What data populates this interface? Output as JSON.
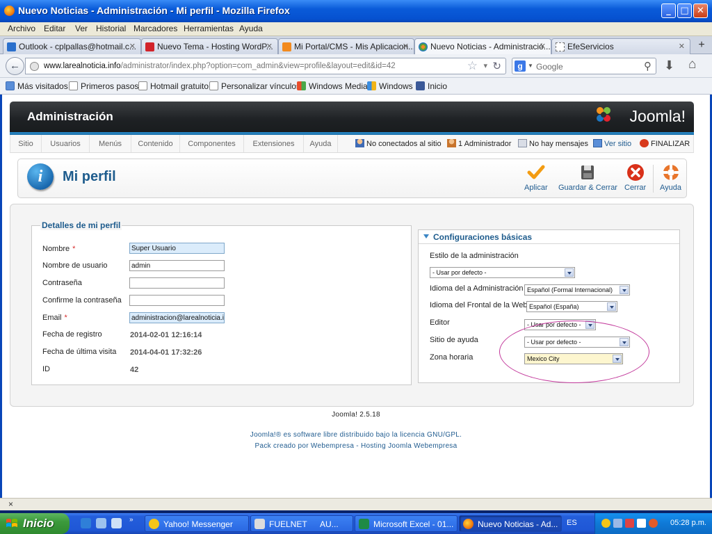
{
  "window": {
    "title": "Nuevo Noticias - Administración - Mi perfil - Mozilla Firefox"
  },
  "menubar": [
    "Archivo",
    "Editar",
    "Ver",
    "Historial",
    "Marcadores",
    "Herramientas",
    "Ayuda"
  ],
  "tabs": [
    {
      "label": "Outlook - cplpallas@hotmail.c..."
    },
    {
      "label": "Nuevo Tema - Hosting WordP..."
    },
    {
      "label": "Mi Portal/CMS - Mis Aplicacion..."
    },
    {
      "label": "Nuevo Noticias - Administració..."
    },
    {
      "label": "EfeServicios"
    }
  ],
  "navbar": {
    "url_domain": "www.larealnoticia.info",
    "url_path": "/administrator/index.php?option=com_admin&view=profile&layout=edit&id=42",
    "search_placeholder": "Google"
  },
  "bookmarks": [
    "Más visitados",
    "Primeros pasos",
    "Hotmail gratuito",
    "Personalizar vínculos",
    "Windows Media",
    "Windows",
    "Inicio"
  ],
  "joomla": {
    "header_title": "Administración",
    "logo_text": "Joomla!",
    "menu": [
      "Sitio",
      "Usuarios",
      "Menús",
      "Contenido",
      "Componentes",
      "Extensiones",
      "Ayuda"
    ],
    "status": {
      "not_connected": "No conectados al sitio",
      "admins": "1 Administrador",
      "messages": "No hay mensajes",
      "view_site": "Ver sitio",
      "logout": "FINALIZAR"
    },
    "page_title": "Mi perfil",
    "toolbar": {
      "apply": "Aplicar",
      "save_close": "Guardar & Cerrar",
      "close": "Cerrar",
      "help": "Ayuda"
    },
    "profile": {
      "legend": "Detalles de mi perfil",
      "name_label": "Nombre",
      "name_value": "Super Usuario",
      "username_label": "Nombre de usuario",
      "username_value": "admin",
      "password_label": "Contraseña",
      "password_value": "",
      "confirm_label": "Confirme la contraseña",
      "confirm_value": "",
      "email_label": "Email",
      "email_value": "administracion@larealnoticia.info",
      "register_label": "Fecha de registro",
      "register_value": "2014-02-01 12:16:14",
      "lastvisit_label": "Fecha de última visita",
      "lastvisit_value": "2014-04-01 17:32:26",
      "id_label": "ID",
      "id_value": "42"
    },
    "settings": {
      "header": "Configuraciones básicas",
      "admin_style_label": "Estilo de la administración",
      "admin_style_value": "- Usar por defecto -",
      "admin_lang_label": "Idioma del a Administración",
      "admin_lang_value": "Español (Formal Internacional)",
      "site_lang_label": "Idioma del Frontal de la Web",
      "site_lang_value": "Español (España)",
      "editor_label": "Editor",
      "editor_value": "- Usar por defecto -",
      "help_site_label": "Sitio de ayuda",
      "help_site_value": "- Usar por defecto -",
      "timezone_label": "Zona horaria",
      "timezone_value": "Mexico City"
    },
    "footer": {
      "version": "Joomla! 2.5.18",
      "license": "Joomla!® es software libre distribuido bajo la licencia GNU/GPL.",
      "pack": "Pack creado por Webempresa - Hosting Joomla Webempresa"
    }
  },
  "statusbar": {
    "close": "×"
  },
  "taskbar": {
    "start": "Inicio",
    "items": [
      "Yahoo! Messenger",
      "FUELNET",
      "AU...",
      "Microsoft Excel - 01...",
      "Nuevo Noticias - Ad..."
    ],
    "lang": "ES",
    "clock": "05:28 p.m."
  }
}
